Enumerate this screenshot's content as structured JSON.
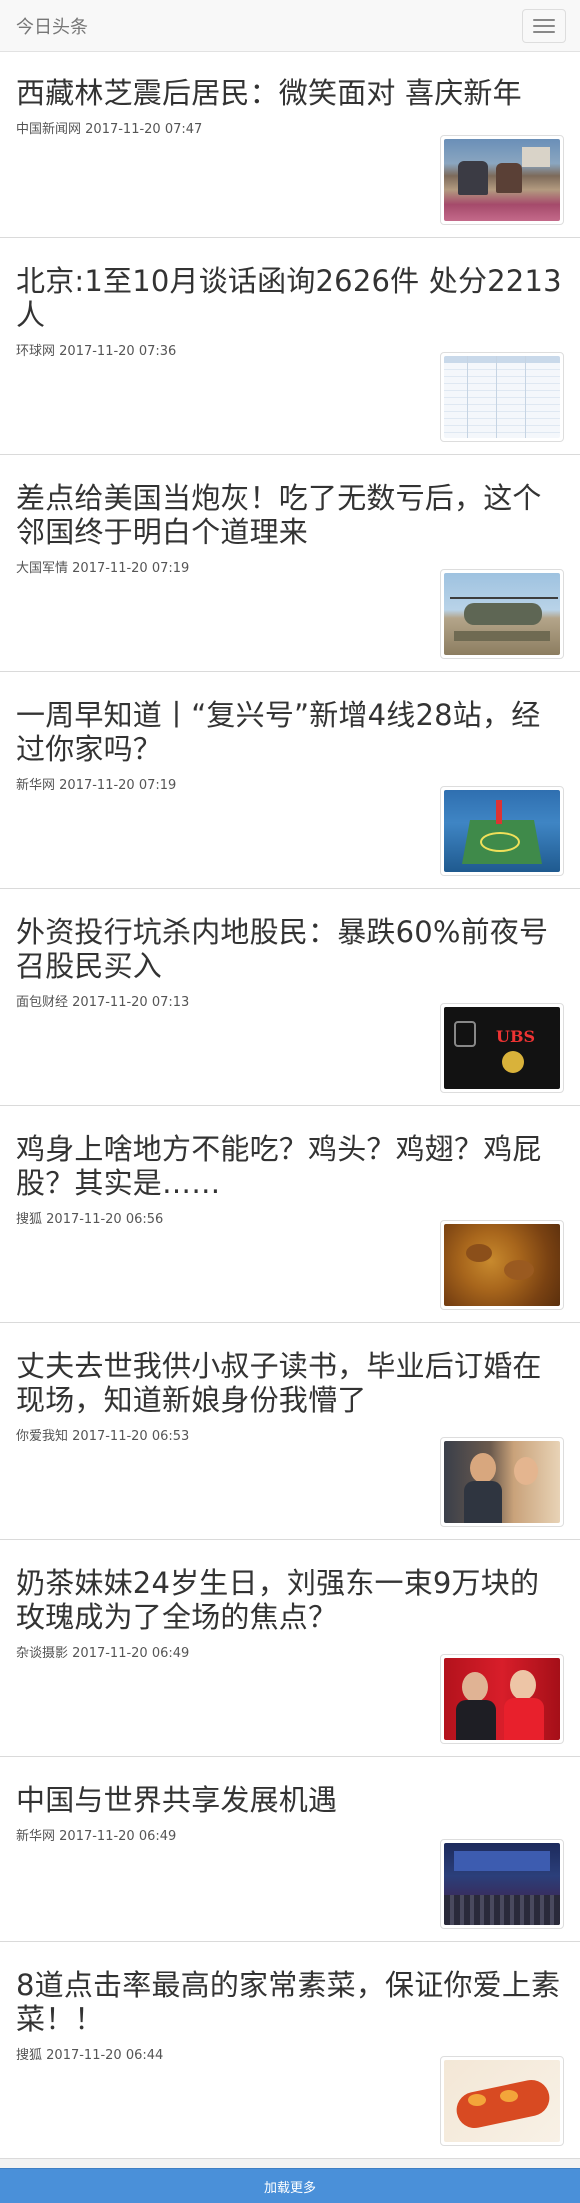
{
  "brand": "今日头条",
  "articles": [
    {
      "title": "西藏林芝震后居民：微笑面对 喜庆新年",
      "source": "中国新闻网",
      "time": "2017-11-20 07:47"
    },
    {
      "title": "北京:1至10月谈话函询2626件 处分2213人",
      "source": "环球网",
      "time": "2017-11-20 07:36"
    },
    {
      "title": "差点给美国当炮灰！吃了无数亏后，这个邻国终于明白个道理来",
      "source": "大国军情",
      "time": "2017-11-20 07:19"
    },
    {
      "title": "一周早知道丨“复兴号”新增4线28站，经过你家吗？",
      "source": "新华网",
      "time": "2017-11-20 07:19"
    },
    {
      "title": "外资投行坑杀内地股民：暴跌60%前夜号召股民买入",
      "source": "面包财经",
      "time": "2017-11-20 07:13"
    },
    {
      "title": "鸡身上啥地方不能吃？鸡头？鸡翅？鸡屁股？其实是……",
      "source": "搜狐",
      "time": "2017-11-20 06:56"
    },
    {
      "title": "丈夫去世我供小叔子读书，毕业后订婚在现场，知道新娘身份我懵了",
      "source": "你爱我知",
      "time": "2017-11-20 06:53"
    },
    {
      "title": "奶茶妹妹24岁生日，刘强东一束9万块的玫瑰成为了全场的焦点？",
      "source": "杂谈摄影",
      "time": "2017-11-20 06:49"
    },
    {
      "title": "中国与世界共享发展机遇",
      "source": "新华网",
      "time": "2017-11-20 06:49"
    },
    {
      "title": "8道点击率最高的家常素菜，保证你爱上素菜！！",
      "source": "搜狐",
      "time": "2017-11-20 06:44"
    }
  ],
  "load_more": "加载更多"
}
